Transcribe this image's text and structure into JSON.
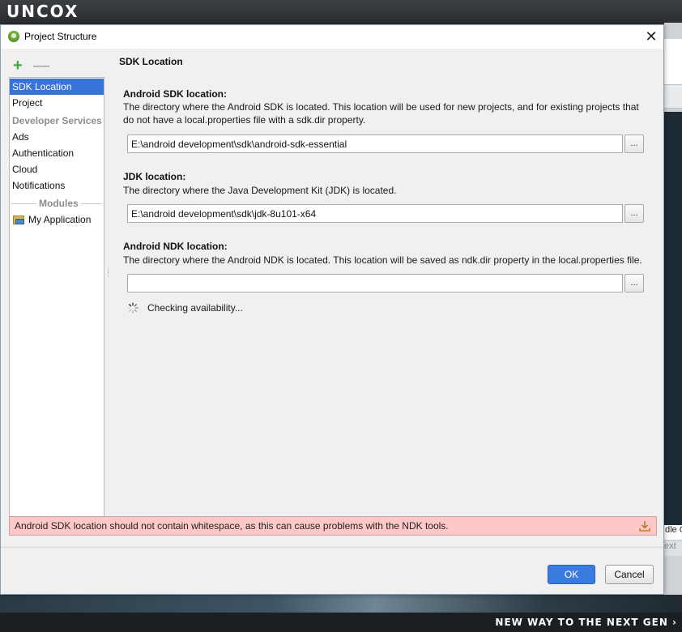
{
  "branding": {
    "logo": "UNCOX",
    "tagline": "NEW WAY TO THE NEXT GEN ›"
  },
  "background": {
    "peek_text_1": "dle G",
    "peek_text_2": "ext"
  },
  "dialog": {
    "title": "Project Structure",
    "close_glyph": "✕",
    "toolbar": {
      "add_glyph": "+",
      "remove_glyph": "—"
    },
    "sidebar": {
      "items": [
        {
          "label": "SDK Location",
          "selected": true
        },
        {
          "label": "Project"
        }
      ],
      "developer_services_header": "Developer Services",
      "service_items": [
        {
          "label": "Ads"
        },
        {
          "label": "Authentication"
        },
        {
          "label": "Cloud"
        },
        {
          "label": "Notifications"
        }
      ],
      "modules_header": "Modules",
      "modules": [
        {
          "label": "My Application",
          "icon": "module-folder-icon"
        }
      ]
    },
    "content": {
      "header": "SDK Location",
      "sdk": {
        "label": "Android SDK location:",
        "description": "The directory where the Android SDK is located. This location will be used for new projects, and for existing projects that do not have a local.properties file with a sdk.dir property.",
        "value": "E:\\android development\\sdk\\android-sdk-essential",
        "browse": "..."
      },
      "jdk": {
        "label": "JDK location:",
        "description": "The directory where the Java Development Kit (JDK) is located.",
        "value": "E:\\android development\\sdk\\jdk-8u101-x64",
        "browse": "..."
      },
      "ndk": {
        "label": "Android NDK location:",
        "description": "The directory where the Android NDK is located. This location will be saved as ndk.dir property in the local.properties file.",
        "value": "",
        "browse": "...",
        "status": "Checking availability..."
      }
    },
    "error": {
      "message": "Android SDK location should not contain whitespace, as this can cause problems with the NDK tools."
    },
    "buttons": {
      "ok": "OK",
      "cancel": "Cancel"
    }
  },
  "colors": {
    "selection": "#3874d8",
    "error_background": "#ffc8c8",
    "ok_button": "#3a7be0",
    "add_icon": "#3cab3c"
  }
}
